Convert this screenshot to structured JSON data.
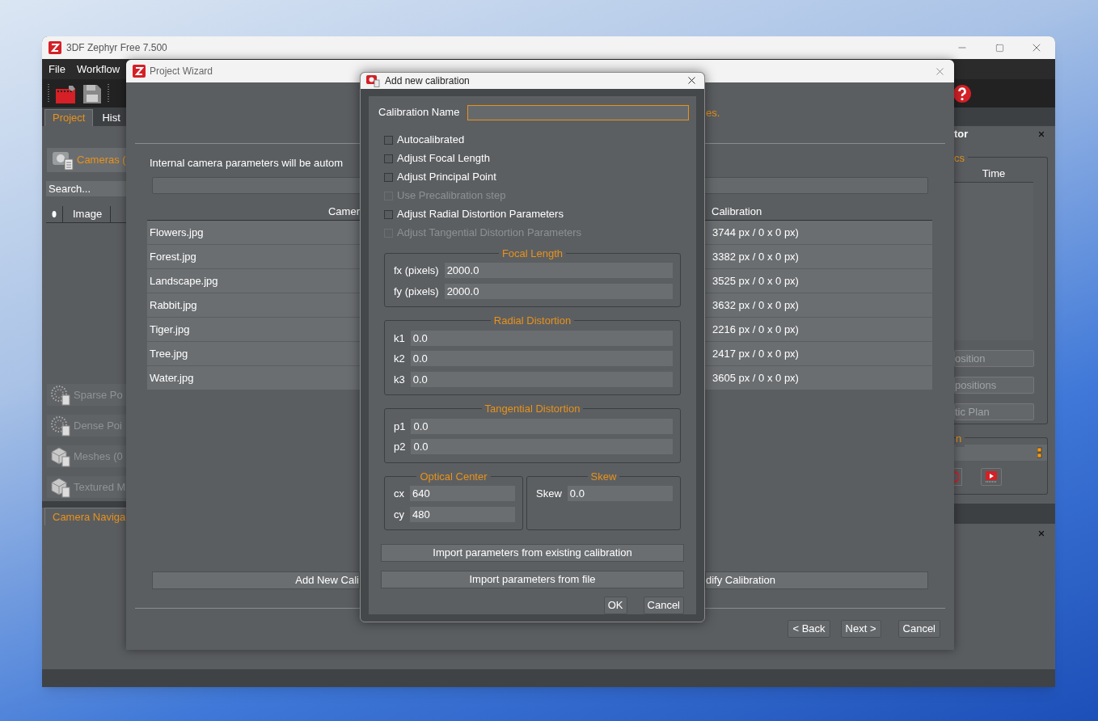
{
  "main_window": {
    "title": "3DF Zephyr Free 7.500",
    "menu": [
      "File",
      "Workflow"
    ],
    "tabs": [
      {
        "label": "Project",
        "selected": true
      },
      {
        "label": "Hist",
        "selected": false
      }
    ],
    "cameras_button": "Cameras (",
    "search": {
      "placeholder": "Search..."
    },
    "table_columns": [
      "Image"
    ],
    "workspace_items": [
      {
        "label": "Sparse Po",
        "kind": "points",
        "disabled": true
      },
      {
        "label": "Dense Poi",
        "kind": "points",
        "disabled": true
      },
      {
        "label": "Meshes (0",
        "kind": "mesh",
        "disabled": true
      },
      {
        "label": "Textured M",
        "kind": "mesh",
        "disabled": true
      }
    ],
    "bottom_tab": "Camera Naviga",
    "right_panel": {
      "title": "tor",
      "group_title": "cs",
      "column": "Time",
      "buttons": [
        "osition",
        "positions",
        "tic Plan"
      ],
      "group2_title": "n"
    }
  },
  "wizard": {
    "title": "Project Wizard",
    "note": "es.",
    "instruction": "Internal camera parameters will be autom",
    "columns": [
      "Camer",
      "Calibration"
    ],
    "rows": [
      {
        "camera": "Flowers.jpg",
        "calibration": "3744 px / 0 x 0 px)"
      },
      {
        "camera": "Forest.jpg",
        "calibration": "3382 px / 0 x 0 px)"
      },
      {
        "camera": "Landscape.jpg",
        "calibration": "3525 px / 0 x 0 px)"
      },
      {
        "camera": "Rabbit.jpg",
        "calibration": "3632 px / 0 x 0 px)"
      },
      {
        "camera": "Tiger.jpg",
        "calibration": "2216 px / 0 x 0 px)"
      },
      {
        "camera": "Tree.jpg",
        "calibration": "2417 px / 0 x 0 px)"
      },
      {
        "camera": "Water.jpg",
        "calibration": "3605 px / 0 x 0 px)"
      }
    ],
    "buttons": [
      "Add New Cali",
      "dify Calibration"
    ],
    "nav_buttons": [
      "< Back",
      "Next >",
      "Cancel"
    ]
  },
  "dialog": {
    "title": "Add new calibration",
    "name_label": "Calibration Name",
    "options": [
      {
        "label": "Autocalibrated",
        "checked": false,
        "disabled": false
      },
      {
        "label": "Adjust Focal Length",
        "checked": false,
        "disabled": false
      },
      {
        "label": "Adjust Principal Point",
        "checked": false,
        "disabled": false
      },
      {
        "label": "Use Precalibration step",
        "checked": false,
        "disabled": true
      },
      {
        "label": "Adjust Radial Distortion Parameters",
        "checked": false,
        "disabled": false
      },
      {
        "label": "Adjust Tangential Distortion Parameters",
        "checked": false,
        "disabled": true
      }
    ],
    "groups": [
      {
        "title": "Focal Length",
        "fields": [
          {
            "label": "fx (pixels)",
            "value": "2000.0"
          },
          {
            "label": "fy (pixels)",
            "value": "2000.0"
          }
        ]
      },
      {
        "title": "Radial Distortion",
        "fields": [
          {
            "label": "k1",
            "value": "0.0"
          },
          {
            "label": "k2",
            "value": "0.0"
          },
          {
            "label": "k3",
            "value": "0.0"
          }
        ]
      },
      {
        "title": "Tangential Distortion",
        "fields": [
          {
            "label": "p1",
            "value": "0.0"
          },
          {
            "label": "p2",
            "value": "0.0"
          }
        ]
      }
    ],
    "side_groups": [
      {
        "title": "Optical Center",
        "fields": [
          {
            "label": "cx",
            "value": "640"
          },
          {
            "label": "cy",
            "value": "480"
          }
        ]
      },
      {
        "title": "Skew",
        "fields": [
          {
            "label": "Skew",
            "value": "0.0"
          }
        ]
      }
    ],
    "import_buttons": [
      "Import parameters from existing calibration",
      "Import parameters from file"
    ],
    "buttons": [
      "OK",
      "Cancel"
    ]
  }
}
